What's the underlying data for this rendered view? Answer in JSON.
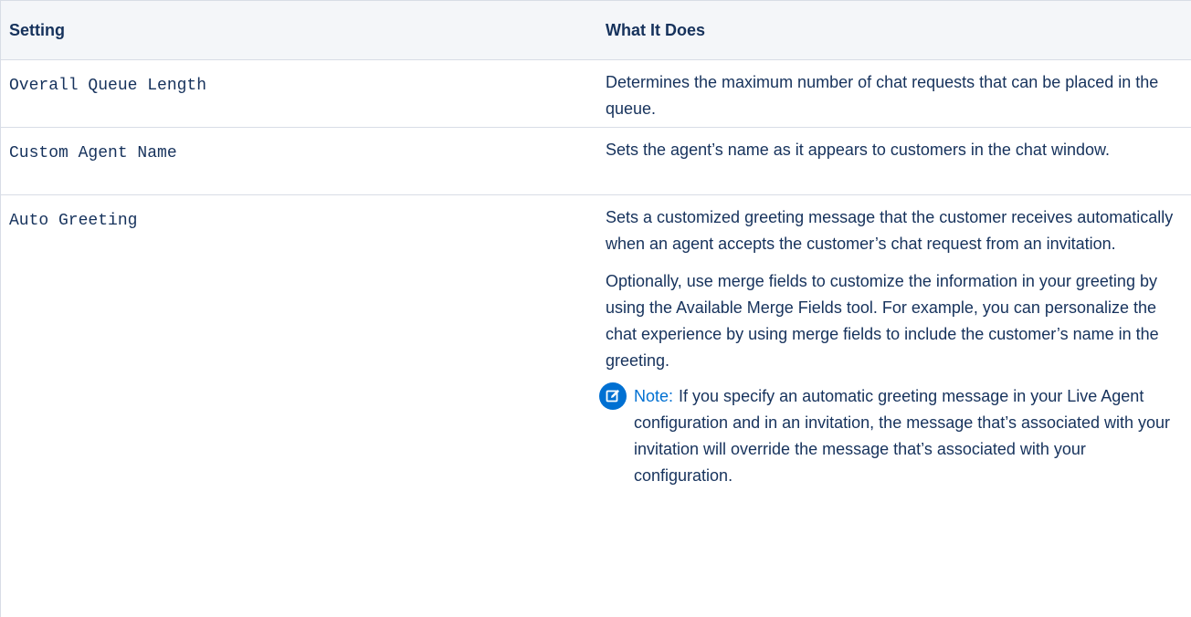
{
  "table": {
    "headers": {
      "setting": "Setting",
      "what_it_does": "What It Does"
    },
    "rows": [
      {
        "setting": "Overall Queue Length",
        "description": [
          "Determines the maximum number of chat requests that can be placed in the queue."
        ]
      },
      {
        "setting": "Custom Agent Name",
        "description": [
          "Sets the agent’s name as it appears to customers in the chat window."
        ]
      },
      {
        "setting": "Auto Greeting",
        "description": [
          "Sets a customized greeting message that the customer receives automatically when an agent accepts the customer’s chat request from an invitation.",
          "Optionally, use merge fields to customize the information in your greeting by using the Available Merge Fields tool. For example, you can personalize the chat experience by using merge fields to include the customer’s name in the greeting."
        ],
        "note": {
          "label": "Note:",
          "text": "If you specify an automatic greeting message in your Live Agent configuration and in an invitation, the message that’s associated with your invitation will override the message that’s associated with your configuration.",
          "icon": "note-edit-icon",
          "icon_color": "#0070d2"
        }
      }
    ]
  },
  "colors": {
    "header_bg": "#f4f6f9",
    "text": "#16325c",
    "border": "#d8dde6",
    "accent": "#0070d2"
  }
}
